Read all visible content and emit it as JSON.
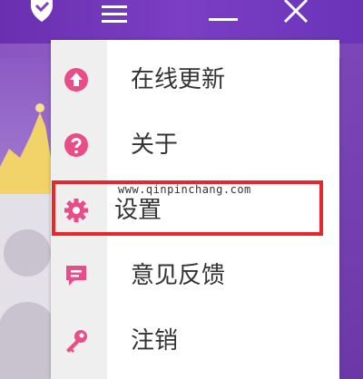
{
  "colors": {
    "titlebar": "#7b3ec4",
    "menu_icon_pink": "#ea4c89",
    "highlight_red": "#e8262b"
  },
  "titlebar": {
    "icons": [
      "shield-check-icon",
      "hamburger-menu-icon",
      "minimize-icon",
      "close-icon"
    ]
  },
  "menu": {
    "items": [
      {
        "label": "在线更新",
        "icon": "upload-circle-icon"
      },
      {
        "label": "关于",
        "icon": "question-circle-icon"
      },
      {
        "label": "设置",
        "icon": "gear-icon"
      },
      {
        "label": "意见反馈",
        "icon": "chat-bubble-icon"
      },
      {
        "label": "注销",
        "icon": "key-icon"
      }
    ]
  },
  "watermark": "www.qinpinchang.com"
}
